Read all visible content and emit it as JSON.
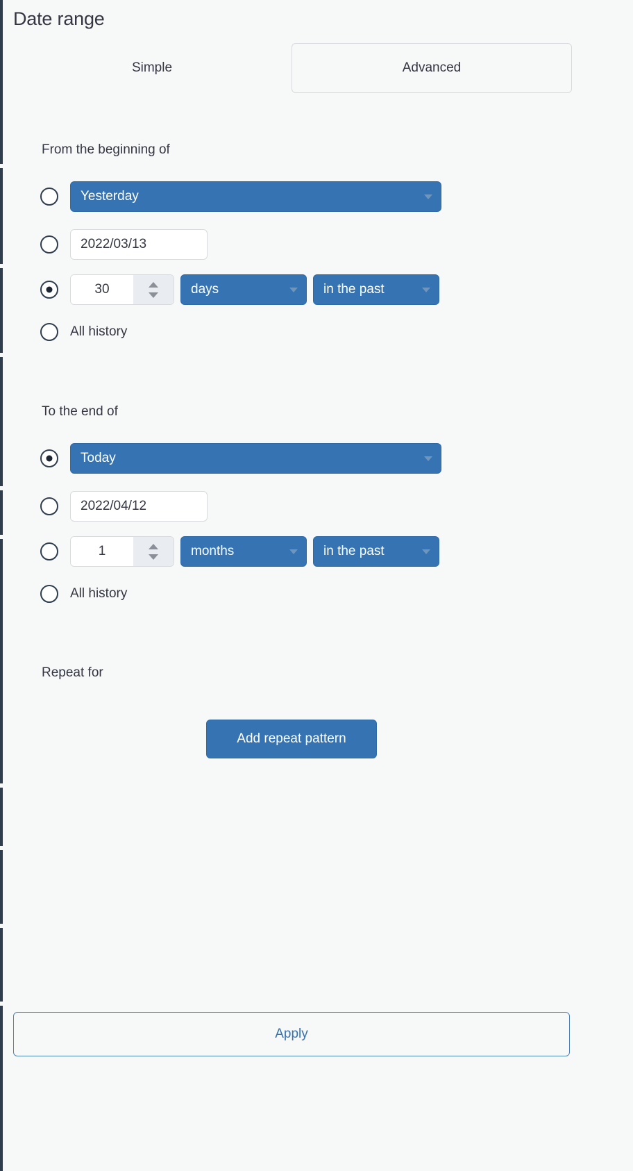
{
  "panel": {
    "title": "Date range"
  },
  "tabs": [
    {
      "label": "Simple",
      "selected": false
    },
    {
      "label": "Advanced",
      "selected": true
    }
  ],
  "from_section": {
    "label": "From the beginning of",
    "options": {
      "preset": {
        "value": "Yesterday",
        "selected": false
      },
      "date": {
        "value": "2022/03/13",
        "selected": false
      },
      "relative": {
        "selected": true,
        "amount": "30",
        "unit": "days",
        "direction": "in the past"
      },
      "all_history": {
        "label": "All history",
        "selected": false
      }
    }
  },
  "to_section": {
    "label": "To the end of",
    "options": {
      "preset": {
        "value": "Today",
        "selected": true
      },
      "date": {
        "value": "2022/04/12",
        "selected": false
      },
      "relative": {
        "selected": false,
        "amount": "1",
        "unit": "months",
        "direction": "in the past"
      },
      "all_history": {
        "label": "All history",
        "selected": false
      }
    }
  },
  "repeat_section": {
    "label": "Repeat for",
    "add_button": "Add repeat pattern"
  },
  "footer": {
    "apply_label": "Apply"
  },
  "colors": {
    "accent_blue": "#3573b3",
    "background": "#f7f8f8",
    "text": "#343741",
    "border": "#d8dadd"
  }
}
